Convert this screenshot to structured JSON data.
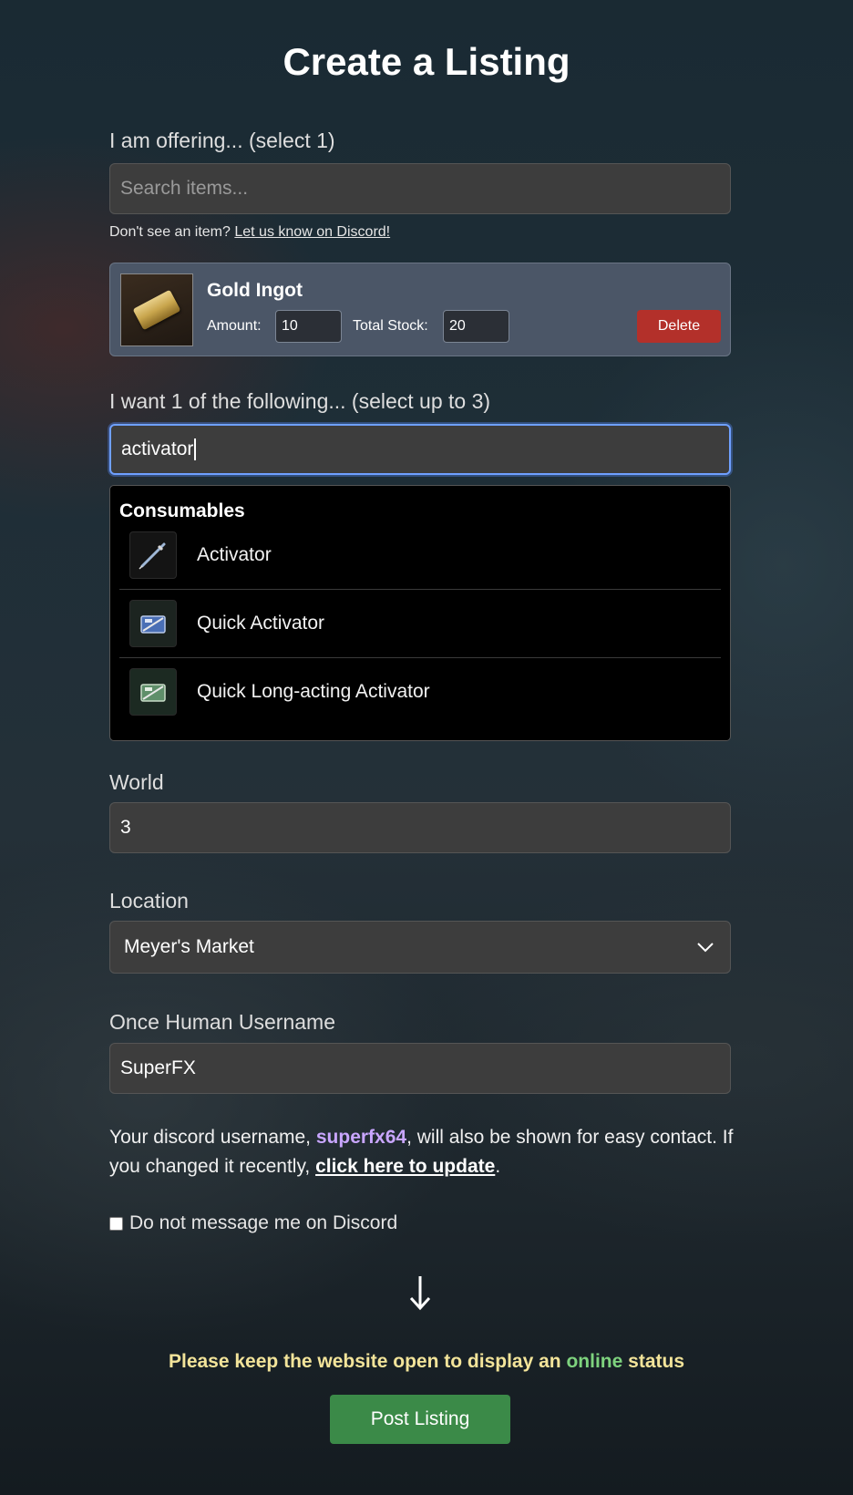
{
  "page": {
    "title": "Create a Listing"
  },
  "offering": {
    "label": "I am offering... (select 1)",
    "search_placeholder": "Search items...",
    "hint_prefix": "Don't see an item? ",
    "hint_link": "Let us know on Discord!",
    "item": {
      "name": "Gold Ingot",
      "icon": "gold-ingot-icon",
      "amount_label": "Amount:",
      "amount_value": "10",
      "stock_label": "Total Stock:",
      "stock_value": "20",
      "delete_label": "Delete"
    }
  },
  "wanting": {
    "label": "I want 1 of the following... (select up to 3)",
    "search_value": "activator",
    "dropdown": {
      "group": "Consumables",
      "options": [
        {
          "label": "Activator",
          "icon": "syringe-icon"
        },
        {
          "label": "Quick Activator",
          "icon": "quick-activator-icon"
        },
        {
          "label": "Quick Long-acting Activator",
          "icon": "long-acting-activator-icon"
        }
      ]
    }
  },
  "world": {
    "label": "World",
    "value": "3"
  },
  "location": {
    "label": "Location",
    "selected": "Meyer's Market"
  },
  "username": {
    "label": "Once Human Username",
    "value": "SuperFX"
  },
  "discord_note": {
    "prefix": "Your discord username, ",
    "username": "superfx64",
    "middle": ", will also be shown for easy contact. If you changed it recently, ",
    "update_link": "click here to update",
    "suffix": "."
  },
  "dont_message": {
    "label": "Do not message me on Discord",
    "checked": false
  },
  "status_note": {
    "prefix": "Please keep the website open to display an ",
    "online": "online",
    "suffix": " status"
  },
  "post_button": {
    "label": "Post Listing"
  },
  "colors": {
    "accent_blue": "#6fa0ff",
    "delete_red": "#b3302a",
    "post_green": "#3b8a48",
    "discord_name": "#c9a6ff",
    "status_yellow": "#f3e49a",
    "online_green": "#7ed37e"
  }
}
